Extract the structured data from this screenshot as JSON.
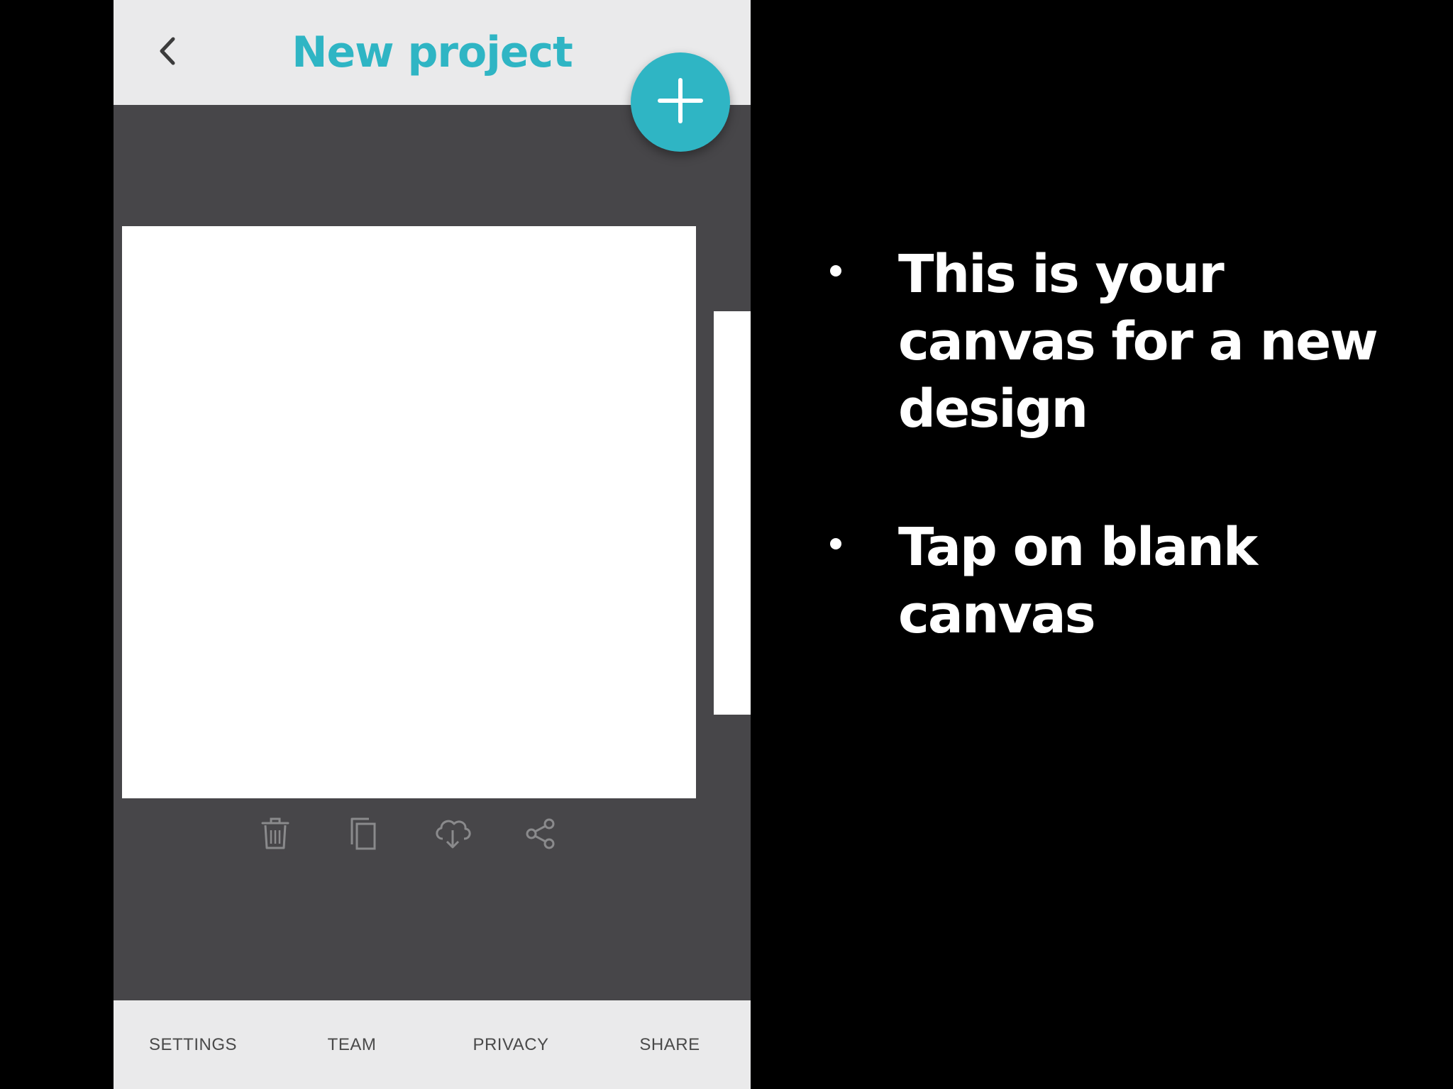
{
  "header": {
    "title": "New project",
    "back_icon": "chevron-left-icon",
    "fab_icon": "plus-icon"
  },
  "canvas_actions": [
    {
      "icon": "trash-icon"
    },
    {
      "icon": "copy-icon"
    },
    {
      "icon": "cloud-download-icon"
    },
    {
      "icon": "share-icon"
    }
  ],
  "bottom_nav": {
    "settings": "SETTINGS",
    "team": "TEAM",
    "privacy": "PRIVACY",
    "share": "SHARE"
  },
  "instructions": [
    "This is your canvas for a new design",
    "Tap on blank canvas"
  ],
  "colors": {
    "accent": "#2fb5c4",
    "workspace": "#474649",
    "bars": "#eaeaeb",
    "background": "#000000"
  }
}
